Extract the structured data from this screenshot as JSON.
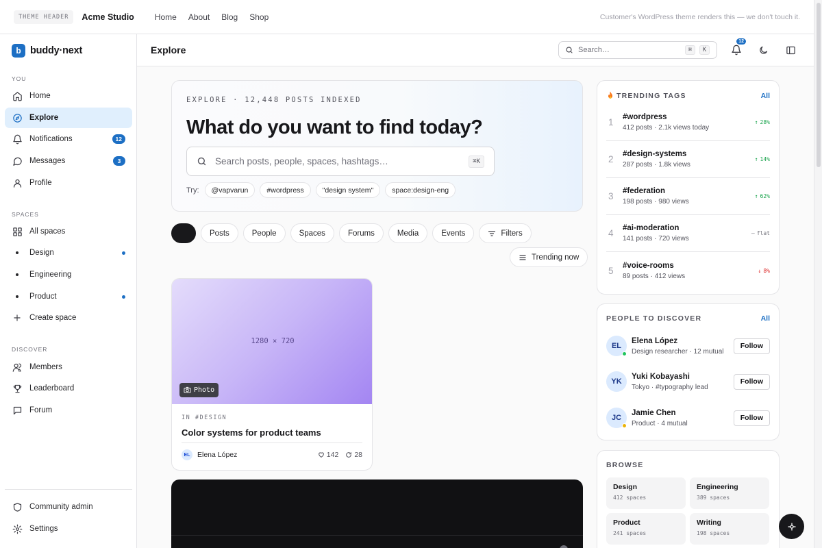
{
  "theme_header": {
    "badge": "THEME HEADER",
    "brand": "Acme Studio",
    "nav": [
      "Home",
      "About",
      "Blog",
      "Shop"
    ],
    "note": "Customer's WordPress theme renders this — we don't touch it."
  },
  "sidebar": {
    "brand_initial": "b",
    "brand_name": "buddy·next",
    "section_you": "YOU",
    "you_items": [
      {
        "label": "Home",
        "icon": "home-icon"
      },
      {
        "label": "Explore",
        "icon": "compass-icon",
        "active": true
      },
      {
        "label": "Notifications",
        "icon": "bell-icon",
        "badge": "12"
      },
      {
        "label": "Messages",
        "icon": "message-icon",
        "badge": "3"
      },
      {
        "label": "Profile",
        "icon": "user-icon"
      }
    ],
    "section_spaces": "SPACES",
    "spaces_items": [
      {
        "label": "All spaces",
        "icon": "grid-icon"
      },
      {
        "label": "Design",
        "dot": true
      },
      {
        "label": "Engineering",
        "dot": false
      },
      {
        "label": "Product",
        "dot": true
      },
      {
        "label": "Create space",
        "icon": "plus-icon"
      }
    ],
    "section_discover": "DISCOVER",
    "discover_items": [
      {
        "label": "Members",
        "icon": "users-icon"
      },
      {
        "label": "Leaderboard",
        "icon": "trophy-icon"
      },
      {
        "label": "Forum",
        "icon": "forum-icon"
      }
    ],
    "footer_items": [
      {
        "label": "Community admin",
        "icon": "shield-icon"
      },
      {
        "label": "Settings",
        "icon": "gear-icon"
      }
    ]
  },
  "topbar": {
    "title": "Explore",
    "search_placeholder": "Search…",
    "kbd_1": "⌘",
    "kbd_2": "K",
    "bell_badge": "12"
  },
  "hero": {
    "kicker": "EXPLORE · 12,448 POSTS INDEXED",
    "title": "What do you want to find today?",
    "search_placeholder": "Search posts, people, spaces, hashtags…",
    "search_kbd": "⌘K",
    "try_label": "Try:",
    "suggestions": [
      "@vapvarun",
      "#wordpress",
      "\"design system\"",
      "space:design-eng"
    ]
  },
  "filters": {
    "items": [
      "Posts",
      "People",
      "Spaces",
      "Forums",
      "Media",
      "Events"
    ],
    "filters_label": "Filters",
    "sort_label": "Trending now"
  },
  "post": {
    "media_dims": "1280 × 720",
    "media_tag": "Photo",
    "space": "IN #DESIGN",
    "title": "Color systems for product teams",
    "author_initials": "EL",
    "author": "Elena López",
    "likes": "142",
    "reposts": "28"
  },
  "trending": {
    "title": "TRENDING TAGS",
    "all_label": "All",
    "tags": [
      {
        "rank": "1",
        "name": "#wordpress",
        "meta": "412 posts · 2.1k views today",
        "trend": "28%",
        "dir": "up"
      },
      {
        "rank": "2",
        "name": "#design-systems",
        "meta": "287 posts · 1.8k views",
        "trend": "14%",
        "dir": "up"
      },
      {
        "rank": "3",
        "name": "#federation",
        "meta": "198 posts · 980 views",
        "trend": "62%",
        "dir": "up"
      },
      {
        "rank": "4",
        "name": "#ai-moderation",
        "meta": "141 posts · 720 views",
        "trend": "flat",
        "dir": "flat"
      },
      {
        "rank": "5",
        "name": "#voice-rooms",
        "meta": "89 posts · 412 views",
        "trend": "8%",
        "dir": "down"
      }
    ]
  },
  "people": {
    "title": "PEOPLE TO DISCOVER",
    "all_label": "All",
    "follow_label": "Follow",
    "items": [
      {
        "initials": "EL",
        "name": "Elena López",
        "meta": "Design researcher · 12 mutual",
        "status": "online"
      },
      {
        "initials": "YK",
        "name": "Yuki Kobayashi",
        "meta": "Tokyo · #typography lead",
        "status": "none"
      },
      {
        "initials": "JC",
        "name": "Jamie Chen",
        "meta": "Product · 4 mutual",
        "status": "away"
      }
    ]
  },
  "browse": {
    "title": "BROWSE",
    "items": [
      {
        "name": "Design",
        "count": "412 spaces"
      },
      {
        "name": "Engineering",
        "count": "389 spaces"
      },
      {
        "name": "Product",
        "count": "241 spaces"
      },
      {
        "name": "Writing",
        "count": "198 spaces"
      }
    ]
  },
  "colors": {
    "accent": "#1d6fc4",
    "trend_up": "#16a34a",
    "trend_down": "#dc2626",
    "trend_flat": "#71717a",
    "status_online": "#22c55e",
    "status_away": "#eab308"
  }
}
